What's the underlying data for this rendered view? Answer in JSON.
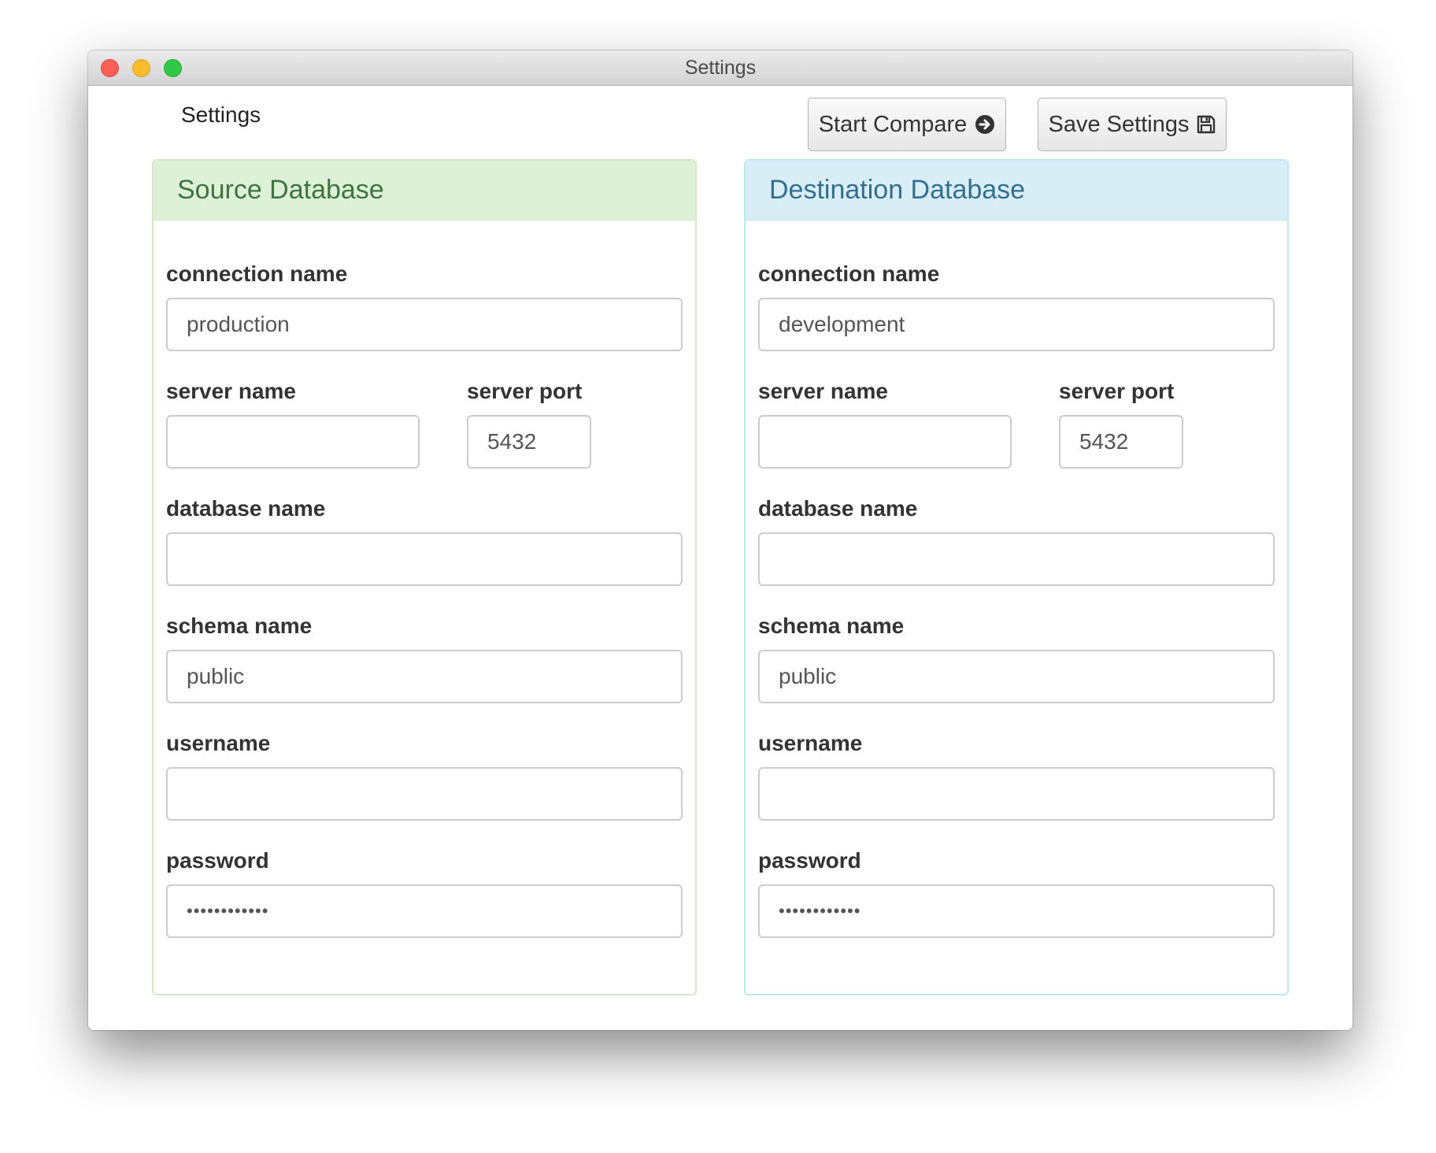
{
  "window": {
    "title": "Settings"
  },
  "page": {
    "label": "Settings"
  },
  "toolbar": {
    "start_compare_label": "Start Compare",
    "start_compare_icon": "arrow-circle-right-icon",
    "save_settings_label": "Save Settings",
    "save_settings_icon": "floppy-disk-icon"
  },
  "source": {
    "header": "Source Database",
    "color": "#3c763d",
    "background": "#dff0d8",
    "fields": {
      "connection_name": {
        "label": "connection name",
        "value": "production"
      },
      "server_name": {
        "label": "server name",
        "value": ""
      },
      "server_port": {
        "label": "server port",
        "value": "5432"
      },
      "database_name": {
        "label": "database name",
        "value": ""
      },
      "schema_name": {
        "label": "schema name",
        "value": "public"
      },
      "username": {
        "label": "username",
        "value": ""
      },
      "password": {
        "label": "password",
        "value": "••••••••••••"
      }
    }
  },
  "destination": {
    "header": "Destination Database",
    "color": "#31708f",
    "background": "#d9edf7",
    "fields": {
      "connection_name": {
        "label": "connection name",
        "value": "development"
      },
      "server_name": {
        "label": "server name",
        "value": ""
      },
      "server_port": {
        "label": "server port",
        "value": "5432"
      },
      "database_name": {
        "label": "database name",
        "value": ""
      },
      "schema_name": {
        "label": "schema name",
        "value": "public"
      },
      "username": {
        "label": "username",
        "value": ""
      },
      "password": {
        "label": "password",
        "value": "••••••••••••"
      }
    }
  }
}
